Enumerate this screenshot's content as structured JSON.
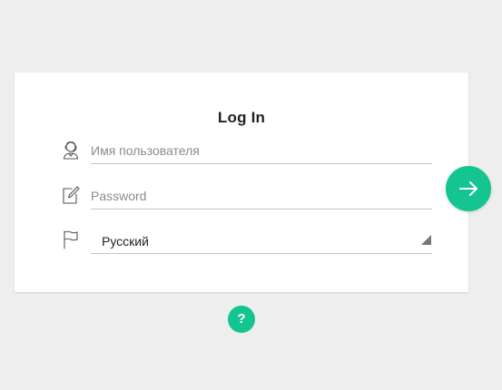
{
  "login": {
    "title": "Log In",
    "username_placeholder": "Имя пользователя",
    "password_placeholder": "Password",
    "language_selected": "Русский"
  },
  "help": {
    "label": "?"
  },
  "icons": {
    "username": "user-headset-icon",
    "password": "edit-icon",
    "language": "flag-icon",
    "submit": "arrow-right-icon",
    "dropdown": "dropdown-triangle-icon"
  },
  "colors": {
    "accent": "#14c591",
    "background": "#eeeeee",
    "card": "#ffffff",
    "underline": "#c4c4c4"
  }
}
